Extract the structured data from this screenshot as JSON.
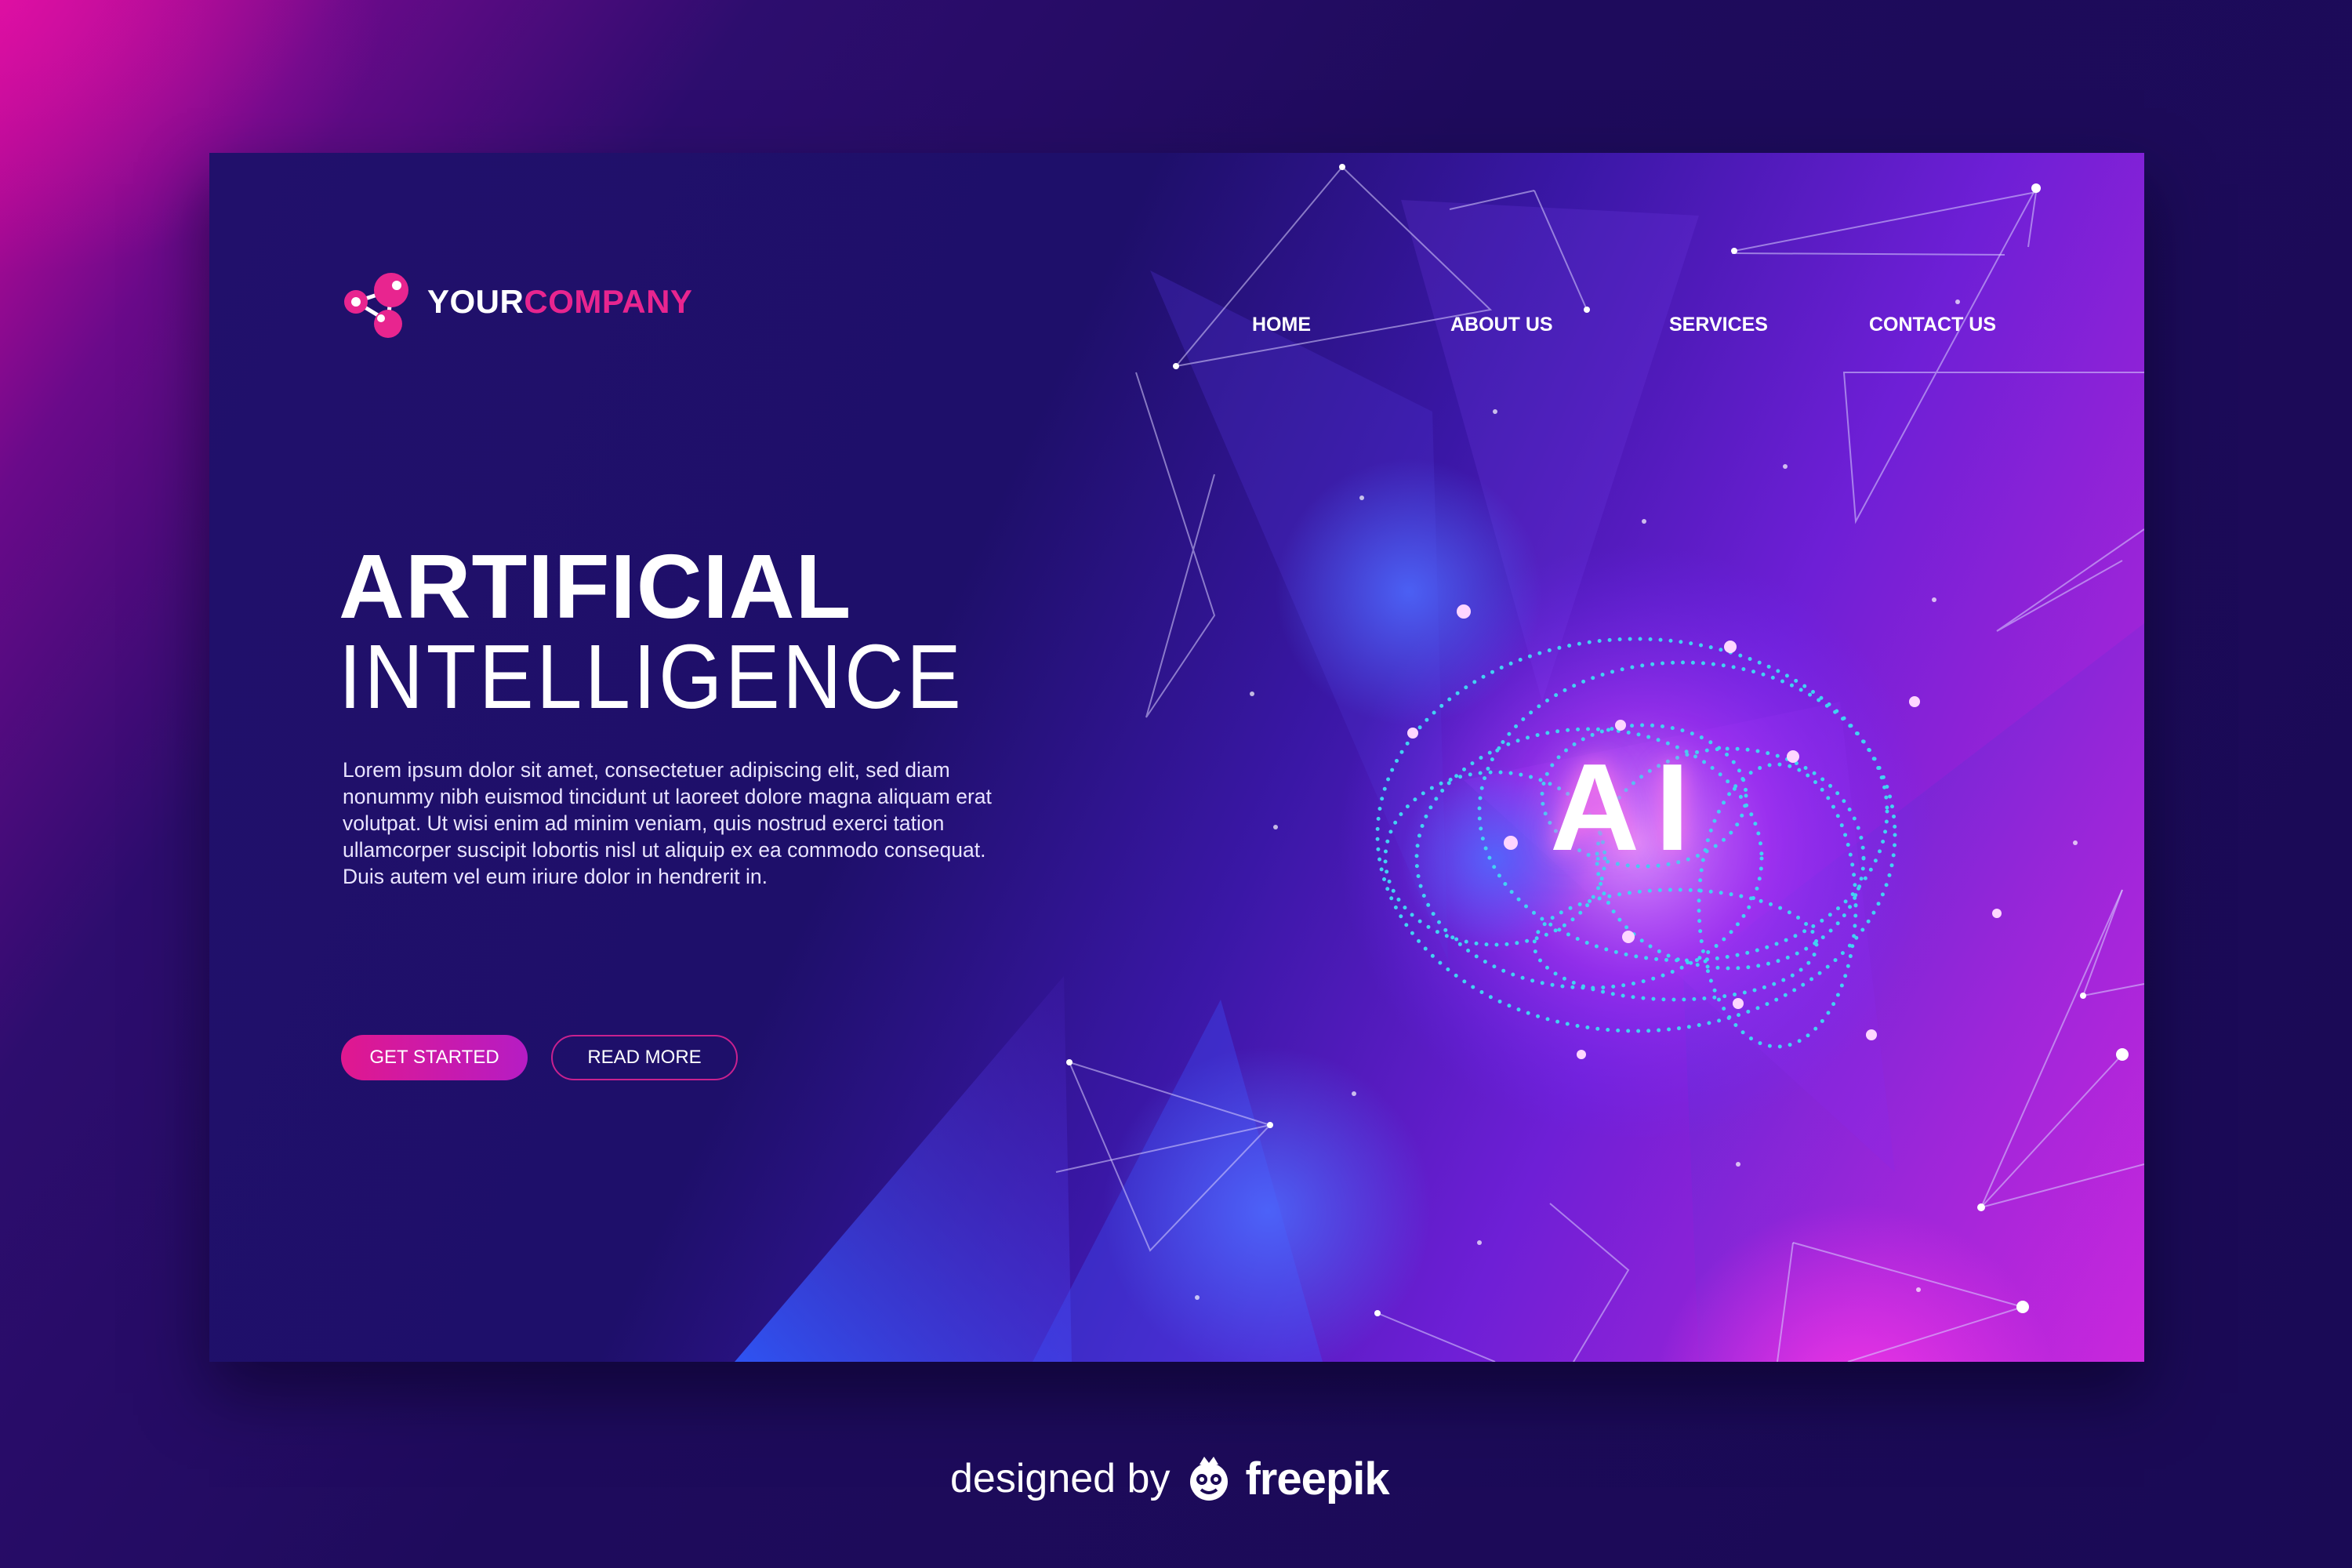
{
  "brand": {
    "logo_icon": "molecule-icon",
    "name_part1": "YOUR",
    "name_part2": "COMPANY"
  },
  "nav": {
    "items": [
      {
        "label": "HOME"
      },
      {
        "label": "ABOUT US"
      },
      {
        "label": "SERVICES"
      },
      {
        "label": "CONTACT US"
      }
    ]
  },
  "hero": {
    "title_line1": "ARTIFICIAL",
    "title_line2": "INTELLIGENCE",
    "body": "Lorem ipsum dolor sit amet, consectetuer adipiscing elit, sed diam nonummy nibh euismod tincidunt ut laoreet dolore magna aliquam erat volutpat. Ut wisi enim ad minim veniam, quis nostrud exerci tation ullamcorper suscipit lobortis nisl ut aliquip ex ea commodo consequat. Duis autem vel eum iriure dolor in hendrerit in.",
    "primary_button": "GET STARTED",
    "secondary_button": "READ MORE"
  },
  "illustration": {
    "label": "AI",
    "icon": "ai-brain-illustration"
  },
  "footer": {
    "designed_by": "designed by",
    "brand": "freepik",
    "icon": "freepik-logo-icon"
  },
  "colors": {
    "accent_pink": "#e8258f",
    "background_navy": "#1e0f6a",
    "glow_purple": "#a425d8",
    "dot_cyan": "#3fd0f0"
  }
}
